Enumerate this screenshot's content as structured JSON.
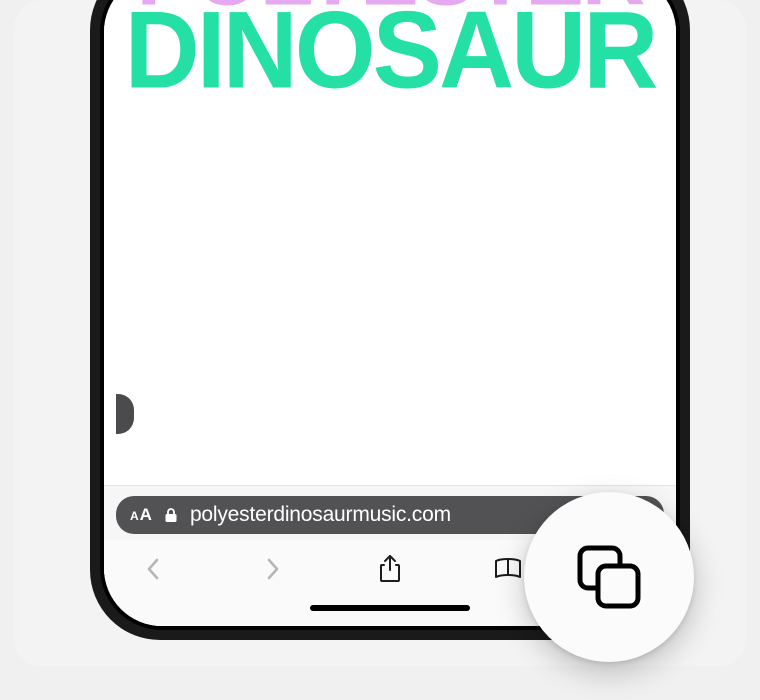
{
  "page": {
    "logo_line1": "POLYESTER",
    "logo_line2": "DINOSAUR"
  },
  "urlbar": {
    "aa_small": "A",
    "aa_big": "A",
    "url_display": "polyesterdinosaurmusic.com"
  },
  "icons": {
    "lock": "lock-icon",
    "refresh": "refresh-icon",
    "back": "back-icon",
    "forward": "forward-icon",
    "share": "share-icon",
    "bookmarks": "bookmarks-icon",
    "tabs": "tabs-icon"
  }
}
